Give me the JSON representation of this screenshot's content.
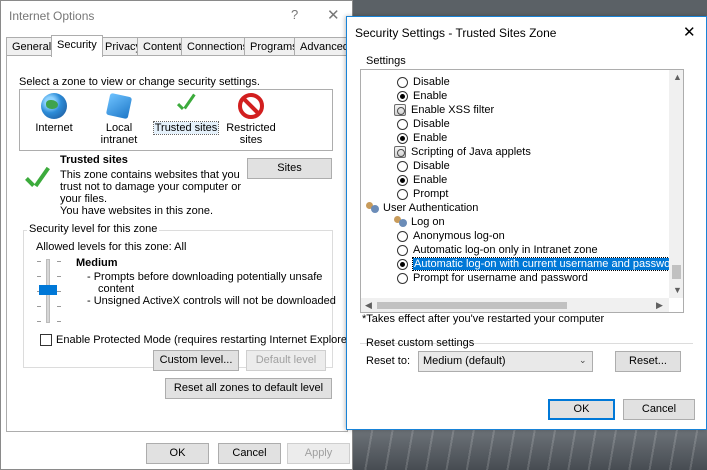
{
  "internet_options": {
    "title": "Internet Options",
    "help_glyph": "?",
    "close_glyph": "✕",
    "tabs": [
      "General",
      "Security",
      "Privacy",
      "Content",
      "Connections",
      "Programs",
      "Advanced"
    ],
    "active_tab": "Security",
    "zone_prompt": "Select a zone to view or change security settings.",
    "zones": [
      {
        "label": "Internet",
        "icon": "globe-icon"
      },
      {
        "label": "Local intranet",
        "icon": "intranet-icon"
      },
      {
        "label": "Trusted sites",
        "icon": "checkmark-icon"
      },
      {
        "label": "Restricted sites",
        "icon": "restricted-icon"
      }
    ],
    "selected_zone": "Trusted sites",
    "zone_heading": "Trusted sites",
    "zone_desc_lines": [
      "This zone contains websites that you",
      "trust not to damage your computer or",
      "your files.",
      "You have websites in this zone."
    ],
    "sites_button": "Sites",
    "security_level_group": "Security level for this zone",
    "allowed_levels": "Allowed levels for this zone: All",
    "level_name": "Medium",
    "level_lines": [
      "- Prompts before downloading potentially unsafe",
      "content",
      "- Unsigned ActiveX controls will not be downloaded"
    ],
    "protected_mode_label": "Enable Protected Mode (requires restarting Internet Explorer)",
    "protected_mode_checked": false,
    "custom_level_button": "Custom level...",
    "default_level_button": "Default level",
    "reset_all_button": "Reset all zones to default level",
    "ok": "OK",
    "cancel": "Cancel",
    "apply": "Apply"
  },
  "security_settings": {
    "title": "Security Settings - Trusted Sites Zone",
    "close_glyph": "✕",
    "settings_label": "Settings",
    "tree": [
      {
        "text": "Disable",
        "kind": "radio",
        "checked": false
      },
      {
        "text": "Enable",
        "kind": "radio",
        "checked": true
      },
      {
        "text": "Enable XSS filter",
        "kind": "setting"
      },
      {
        "text": "Disable",
        "kind": "radio",
        "checked": false
      },
      {
        "text": "Enable",
        "kind": "radio",
        "checked": true
      },
      {
        "text": "Scripting of Java applets",
        "kind": "setting"
      },
      {
        "text": "Disable",
        "kind": "radio",
        "checked": false
      },
      {
        "text": "Enable",
        "kind": "radio",
        "checked": true
      },
      {
        "text": "Prompt",
        "kind": "radio",
        "checked": false
      },
      {
        "text": "User Authentication",
        "kind": "category"
      },
      {
        "text": "Log on",
        "kind": "subcategory"
      },
      {
        "text": "Anonymous log-on",
        "kind": "radio",
        "checked": false
      },
      {
        "text": "Automatic log-on only in Intranet zone",
        "kind": "radio",
        "checked": false
      },
      {
        "text": "Automatic log-on with current username and password",
        "kind": "radio",
        "checked": true,
        "highlighted": true
      },
      {
        "text": "Prompt for username and password",
        "kind": "radio",
        "checked": false
      }
    ],
    "footnote": "*Takes effect after you've restarted your computer",
    "reset_group": "Reset custom settings",
    "reset_to_label": "Reset to:",
    "reset_to_value": "Medium (default)",
    "reset_button": "Reset...",
    "ok": "OK",
    "cancel": "Cancel"
  }
}
